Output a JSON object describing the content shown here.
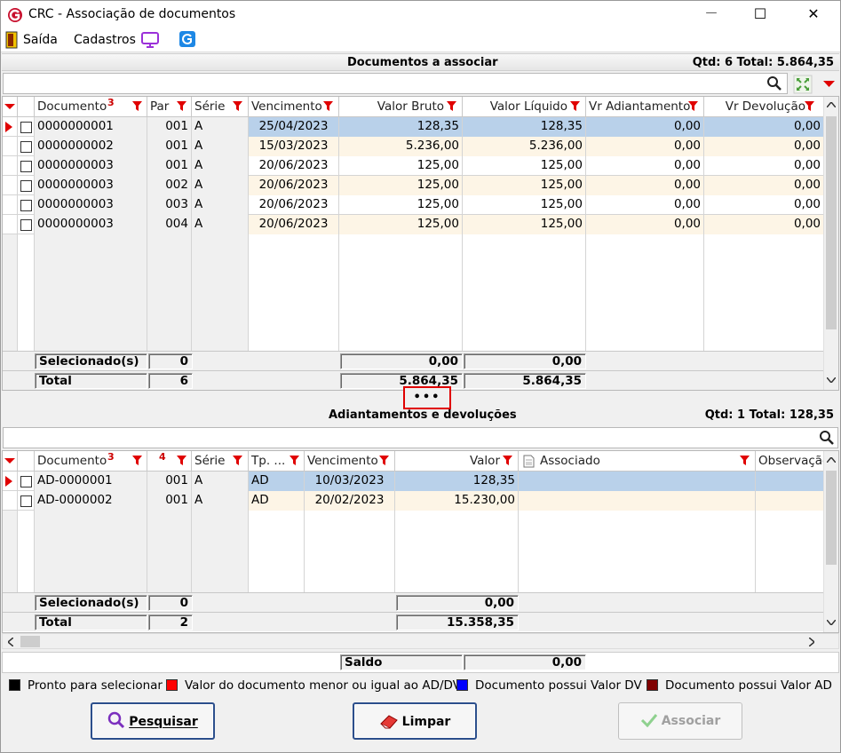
{
  "window": {
    "title": "CRC - Associação de documentos",
    "minimize": "—",
    "maximize": "☐",
    "close": "✕"
  },
  "menu": {
    "saida": "Saída",
    "cadastros": "Cadastros"
  },
  "top": {
    "title": "Documentos a associar",
    "summary": "Qtd: 6 Total: 5.864,35",
    "columns": [
      "Documento",
      "Par",
      "Série",
      "Vencimento",
      "Valor Bruto",
      "Valor Líquido",
      "Vr Adiantamento",
      "Vr Devolução"
    ],
    "sort_badge": "3",
    "rows": [
      [
        "0000000001",
        "001",
        "A",
        "25/04/2023",
        "128,35",
        "128,35",
        "0,00",
        "0,00"
      ],
      [
        "0000000002",
        "001",
        "A",
        "15/03/2023",
        "5.236,00",
        "5.236,00",
        "0,00",
        "0,00"
      ],
      [
        "0000000003",
        "001",
        "A",
        "20/06/2023",
        "125,00",
        "125,00",
        "0,00",
        "0,00"
      ],
      [
        "0000000003",
        "002",
        "A",
        "20/06/2023",
        "125,00",
        "125,00",
        "0,00",
        "0,00"
      ],
      [
        "0000000003",
        "003",
        "A",
        "20/06/2023",
        "125,00",
        "125,00",
        "0,00",
        "0,00"
      ],
      [
        "0000000003",
        "004",
        "A",
        "20/06/2023",
        "125,00",
        "125,00",
        "0,00",
        "0,00"
      ]
    ],
    "selecionados_label": "Selecionado(s)",
    "selecionados_count": "0",
    "selecionados_bruto": "0,00",
    "selecionados_liquido": "0,00",
    "total_label": "Total",
    "total_count": "6",
    "total_bruto": "5.864,35",
    "total_liquido": "5.864,35"
  },
  "splitter": "•••",
  "bottom": {
    "title": "Adiantamentos e devoluções",
    "summary": "Qtd: 1 Total: 128,35",
    "columns": [
      "Documento",
      "",
      "Série",
      "Tp. ...",
      "Vencimento",
      "Valor",
      "Associado",
      "Observação"
    ],
    "sort_badge_doc": "3",
    "sort_badge_par": "4",
    "rows": [
      [
        "AD-0000001",
        "001",
        "A",
        "AD",
        "10/03/2023",
        "128,35",
        "",
        ""
      ],
      [
        "AD-0000002",
        "001",
        "A",
        "AD",
        "20/02/2023",
        "15.230,00",
        "",
        ""
      ]
    ],
    "selecionados_label": "Selecionado(s)",
    "selecionados_count": "0",
    "selecionados_valor": "0,00",
    "total_label": "Total",
    "total_count": "2",
    "total_valor": "15.358,35"
  },
  "saldo": {
    "label": "Saldo",
    "value": "0,00"
  },
  "legend": [
    {
      "label": "Pronto para selecionar",
      "color": "#000000"
    },
    {
      "label": "Valor do documento menor ou igual ao AD/DV",
      "color": "#ff0000"
    },
    {
      "label": "Documento possui Valor DV",
      "color": "#0000ff"
    },
    {
      "label": "Documento possui Valor AD",
      "color": "#800000"
    }
  ],
  "buttons": {
    "pesquisar": "Pesquisar",
    "limpar": "Limpar",
    "associar": "Associar"
  },
  "colors": {
    "filter_red": "#e00000",
    "selected_row": "#b9d1ea",
    "alt_row": "#fdf5e6"
  }
}
